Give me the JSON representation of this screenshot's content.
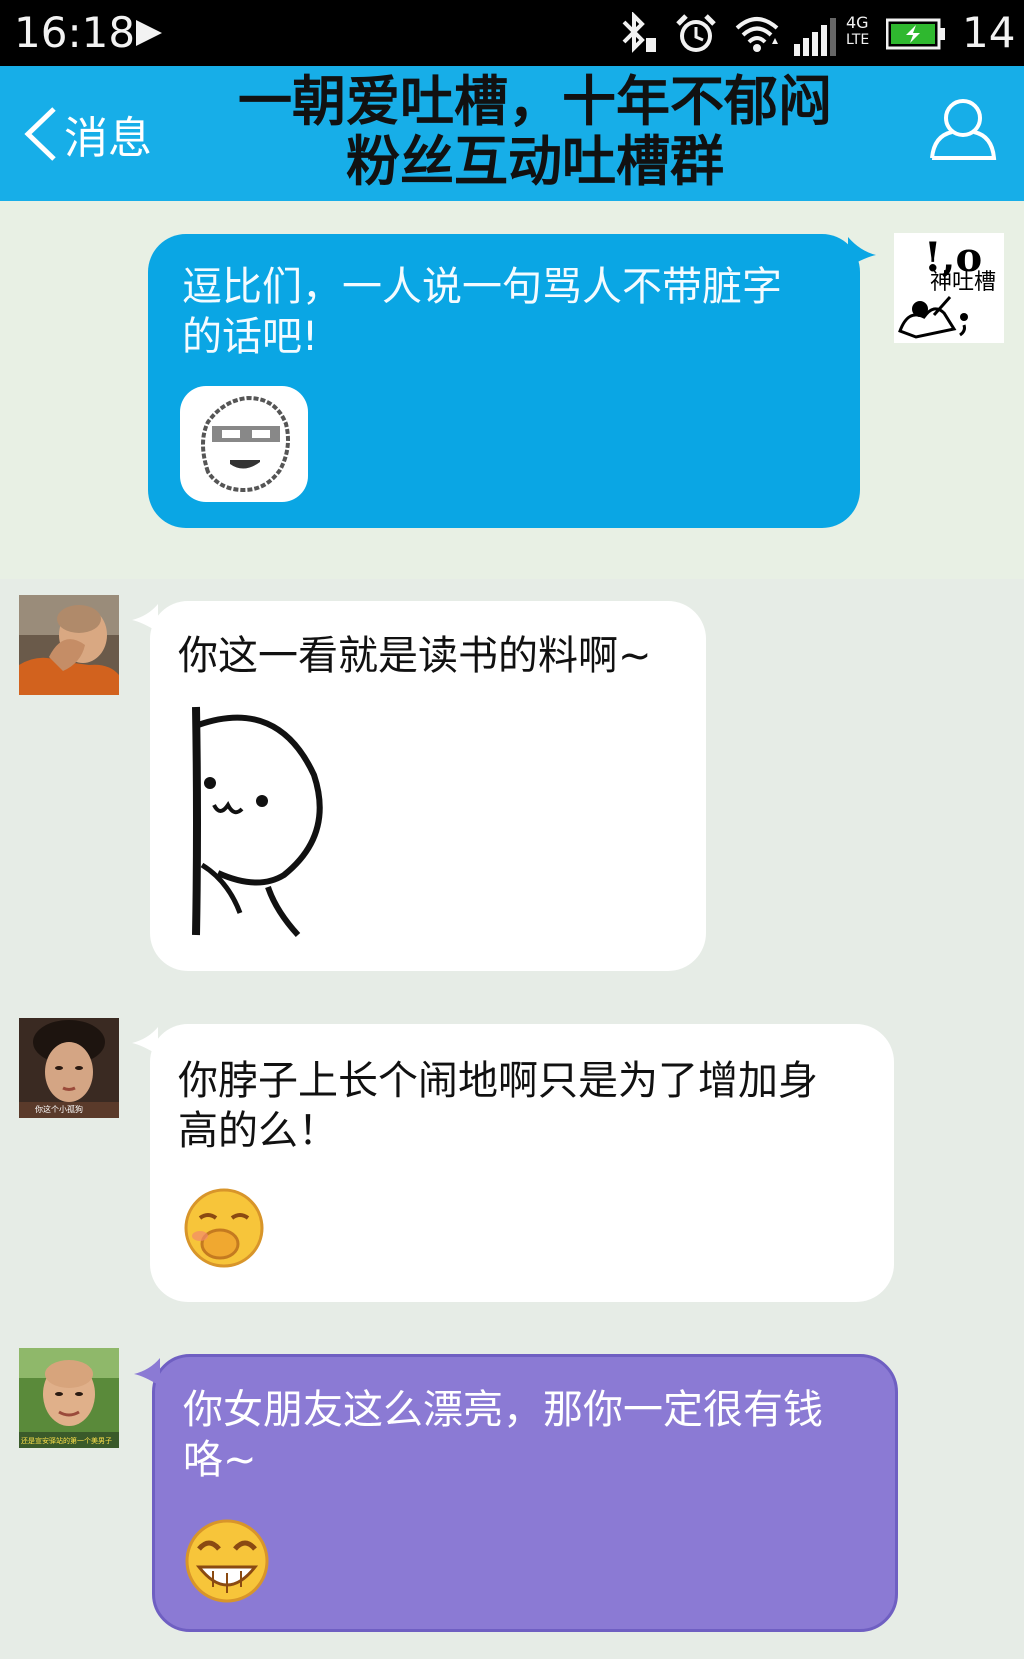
{
  "status_bar": {
    "time": "16:18",
    "network": "4G",
    "network_sub": "LTE",
    "battery_level": "14",
    "icons": [
      "play-icon",
      "bluetooth-icon",
      "alarm-icon",
      "wifi-icon",
      "signal-icon",
      "battery-icon"
    ]
  },
  "header": {
    "back_label": "消息",
    "title_line1": "一朝爱吐槽，十年不郁闷",
    "title_line2": "粉丝互动吐槽群",
    "icons": [
      "chevron-left-icon",
      "profile-icon"
    ]
  },
  "messages": [
    {
      "sender": "self",
      "text": "逗比们，一人说一句骂人不带脏字\n的话吧!",
      "sticker": "smirk-face-sticker",
      "avatar_caption": "神吐槽",
      "avatar_marks": "!,o",
      "bubble_color": "#0aa6e4"
    },
    {
      "sender": "other",
      "text": "你这一看就是读书的料啊~",
      "sticker": "peeking-face-sticker",
      "avatar": "facepalm-monk-avatar",
      "bubble_color": "#ffffff"
    },
    {
      "sender": "other",
      "text": "你脖子上长个闹地啊只是为了增加身\n高的么！",
      "sticker": "snicker-emoji",
      "avatar": "woman-avatar",
      "avatar_caption": "你这个小孤狗",
      "bubble_color": "#ffffff"
    },
    {
      "sender": "other",
      "text": "你女朋友这么漂亮，那你一定很有钱\n咯~",
      "sticker": "grin-emoji",
      "avatar": "monk-avatar",
      "avatar_caption": "还是宣安驿站的第一个美男子",
      "bubble_color": "#8b7ad4"
    }
  ]
}
